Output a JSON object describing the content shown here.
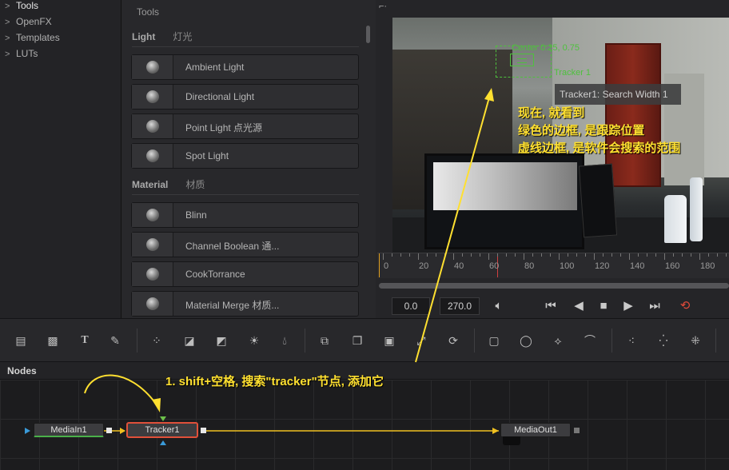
{
  "tree": {
    "items": [
      {
        "label": "Tools",
        "active": true
      },
      {
        "label": "OpenFX"
      },
      {
        "label": "Templates"
      },
      {
        "label": "LUTs"
      }
    ]
  },
  "tools_panel": {
    "title": "Tools",
    "sections": [
      {
        "name": "Light",
        "cn": "灯光",
        "items": [
          "Ambient Light",
          "Directional Light",
          "Point Light 点光源",
          "Spot Light"
        ]
      },
      {
        "name": "Material",
        "cn": "材质",
        "items": [
          "Blinn",
          "Channel Boolean 通...",
          "CookTorrance",
          "Material Merge 材质..."
        ]
      }
    ]
  },
  "viewer": {
    "corner_icon": "crosshair-icon",
    "tracker_center_label": "Center 0.25, 0.75",
    "tracker_name_label": "Tracker 1",
    "tooltip": "Tracker1: Search Width 1",
    "annotation_lines": [
      "现在, 就看到",
      "绿色的边框, 是跟踪位置",
      "虚线边框, 是软件会搜索的范围"
    ],
    "ruler_ticks": [
      "0",
      "20",
      "40",
      "60",
      "80",
      "100",
      "120",
      "140",
      "160",
      "180"
    ],
    "time_start": "0.0",
    "time_end": "270.0"
  },
  "transport": {
    "icons": [
      "speaker-icon",
      "skip-back-icon",
      "play-reverse-icon",
      "stop-icon",
      "play-icon",
      "skip-forward-icon",
      "loop-icon"
    ]
  },
  "toolbar": {
    "icons": [
      "background-icon",
      "fast-noise-icon",
      "text-icon",
      "paint-icon",
      "particle-icon",
      "color-corrector-icon",
      "color-curves-icon",
      "brightness-icon",
      "matte-control-icon",
      "merge-icon",
      "channel-icon",
      "resize-icon",
      "transform-icon",
      "rectangle-mask-icon",
      "ellipse-mask-icon",
      "polygon-mask-icon",
      "bspline-mask-icon",
      "pemitter-icon",
      "prender-icon",
      "shape3d-icon"
    ]
  },
  "nodes": {
    "title": "Nodes",
    "annotation": "1. shift+空格, 搜索\"tracker\"节点, 添加它",
    "node_list": [
      "MediaIn1",
      "Tracker1",
      "MediaOut1"
    ]
  },
  "colors": {
    "tracker_green": "#4ec13d",
    "annotation_yellow": "#ffe030",
    "selected_node_border": "#e0503a",
    "connection_yellow": "#f0c020"
  }
}
